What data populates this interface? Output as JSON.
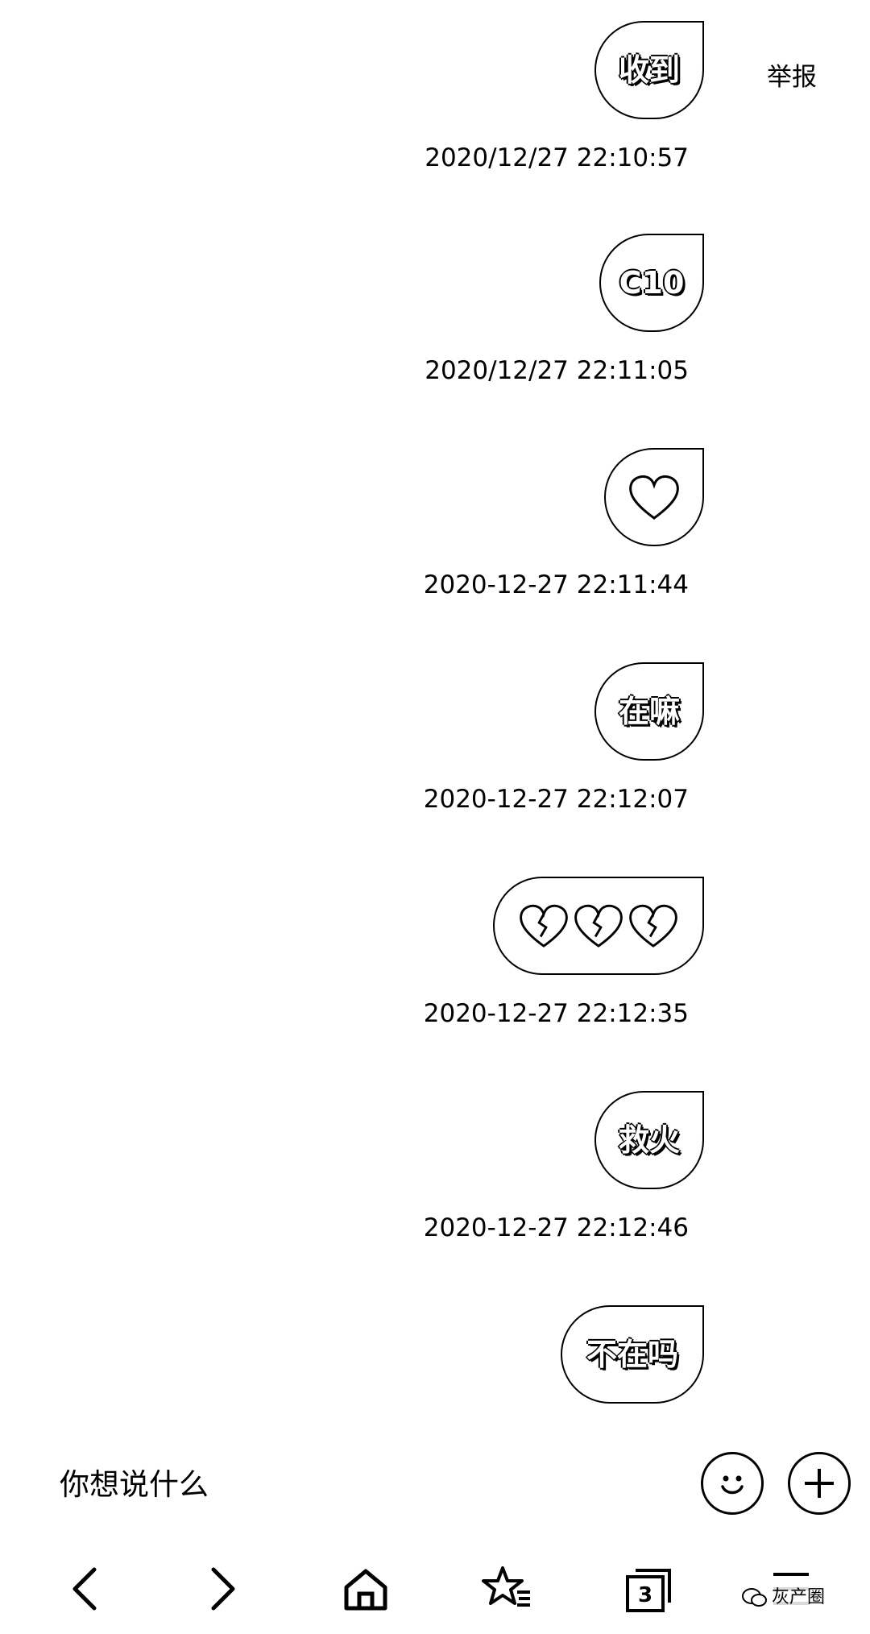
{
  "header": {
    "report_label": "举报"
  },
  "messages": [
    {
      "type": "text",
      "text": "收到",
      "timestamp": "2020/12/27 22:10:57"
    },
    {
      "type": "text",
      "text": "C10",
      "timestamp": "2020/12/27 22:11:05"
    },
    {
      "type": "sticker",
      "icon": "heart-icon",
      "timestamp": "2020-12-27 22:11:44"
    },
    {
      "type": "text",
      "text": "在嘛",
      "timestamp": "2020-12-27 22:12:07"
    },
    {
      "type": "sticker",
      "icon": "broken-heart-icon",
      "count": 3,
      "timestamp": "2020-12-27 22:12:35"
    },
    {
      "type": "text",
      "text": "救火",
      "timestamp": "2020-12-27 22:12:46"
    },
    {
      "type": "text",
      "text": "不在吗",
      "timestamp": ""
    }
  ],
  "input": {
    "placeholder": "你想说什么",
    "emoji_icon": "smiley-icon",
    "add_icon": "plus-icon"
  },
  "nav": {
    "items": [
      "back-arrow-icon",
      "forward-arrow-icon",
      "home-icon",
      "favorites-icon",
      "tabs-icon",
      "menu-icon"
    ],
    "tab_count": "3"
  },
  "watermark": {
    "text": "灰产圈"
  }
}
